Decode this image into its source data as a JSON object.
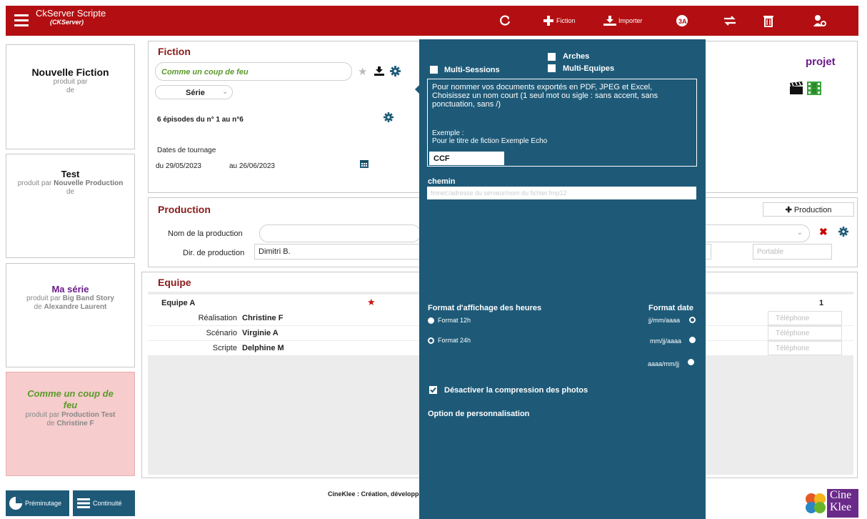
{
  "app": {
    "title": "CkServer Scripte",
    "subtitle": "(CKServer)"
  },
  "toolbar": {
    "fiction_label": "Fiction",
    "importer_label": "Importer"
  },
  "left_cards": [
    {
      "title": "Nouvelle Fiction",
      "line1": "produit par",
      "line2": "de"
    },
    {
      "title": "Test",
      "line1_prefix": "produit par",
      "line1_name": "Nouvelle Production",
      "line2": "de"
    },
    {
      "title": "Ma série",
      "line1_prefix": "produit par",
      "line1_name": "Big Band Story",
      "line2_prefix": "de",
      "line2_name": "Alexandre Laurent"
    },
    {
      "title": "Comme un coup de feu",
      "line1_prefix": "produit par",
      "line1_name": "Production Test",
      "line2_prefix": "de",
      "line2_name": "Christine F"
    }
  ],
  "fiction": {
    "section_title": "Fiction",
    "title_value": "Comme un coup de feu",
    "type_value": "Série",
    "episodes_text": "6 épisodes du n° 1 au n°6",
    "dates_label": "Dates de tournage",
    "date_from": "du 29/05/2023",
    "date_to": "au 26/06/2023",
    "brand": "projet"
  },
  "production": {
    "section_title": "Production",
    "add_button": "Production",
    "name_label": "Nom de la production",
    "name_value": "",
    "dir_label": "Dir. de production",
    "dir_value": "Dimitri B.",
    "portable_placeholder": "Portable"
  },
  "equipe": {
    "section_title": "Equipe",
    "team_name": "Equipe A",
    "count": "1",
    "members": [
      {
        "role": "Réalisation",
        "name": "Christine F",
        "phone_placeholder": "Téléphone"
      },
      {
        "role": "Scénario",
        "name": "Virginie A",
        "phone_placeholder": "Téléphone"
      },
      {
        "role": "Scripte",
        "name": "Delphine M",
        "phone_placeholder": "Téléphone"
      }
    ]
  },
  "overlay": {
    "arches": "Arches",
    "multi_sessions": "Multi-Sessions",
    "multi_equipes": "Multi-Equipes",
    "info_text": "Pour nommer vos documents exportés en PDF, JPEG et Excel, Choisissez un nom court (1 seul mot ou sigle : sans accent, sans ponctuation, sans /)",
    "example_label": "Exemple :",
    "example_text": "Pour le titre de fiction Exemple Echo",
    "short_name": "CCF",
    "chemin_label": "chemin",
    "chemin_placeholder": "fmnet:/adresse du serveur/nom du fichier.fmp12",
    "hours_label": "Format d'affichage des heures",
    "format_12h": "Format 12h",
    "format_24h": "Format 24h",
    "date_label": "Format date",
    "date_opt1": "jj/mm/aaaa",
    "date_opt2": "mm/jj/aaaa",
    "date_opt3": "aaaa/mm/jj",
    "compress_label": "Désactiver la compression des photos",
    "option_label": "Option de personnalisation"
  },
  "footer": {
    "preminutage": "Préminutage",
    "continuite": "Continuité",
    "credits": "CineKlee : Création, développe",
    "logo_top": "Cine",
    "logo_bottom": "Klee"
  },
  "colors": {
    "red": "#b30f12",
    "overlay": "#1e5a78",
    "green": "#5a9a2a",
    "purple": "#6a1b8a",
    "maroon": "#8b1a1a"
  }
}
